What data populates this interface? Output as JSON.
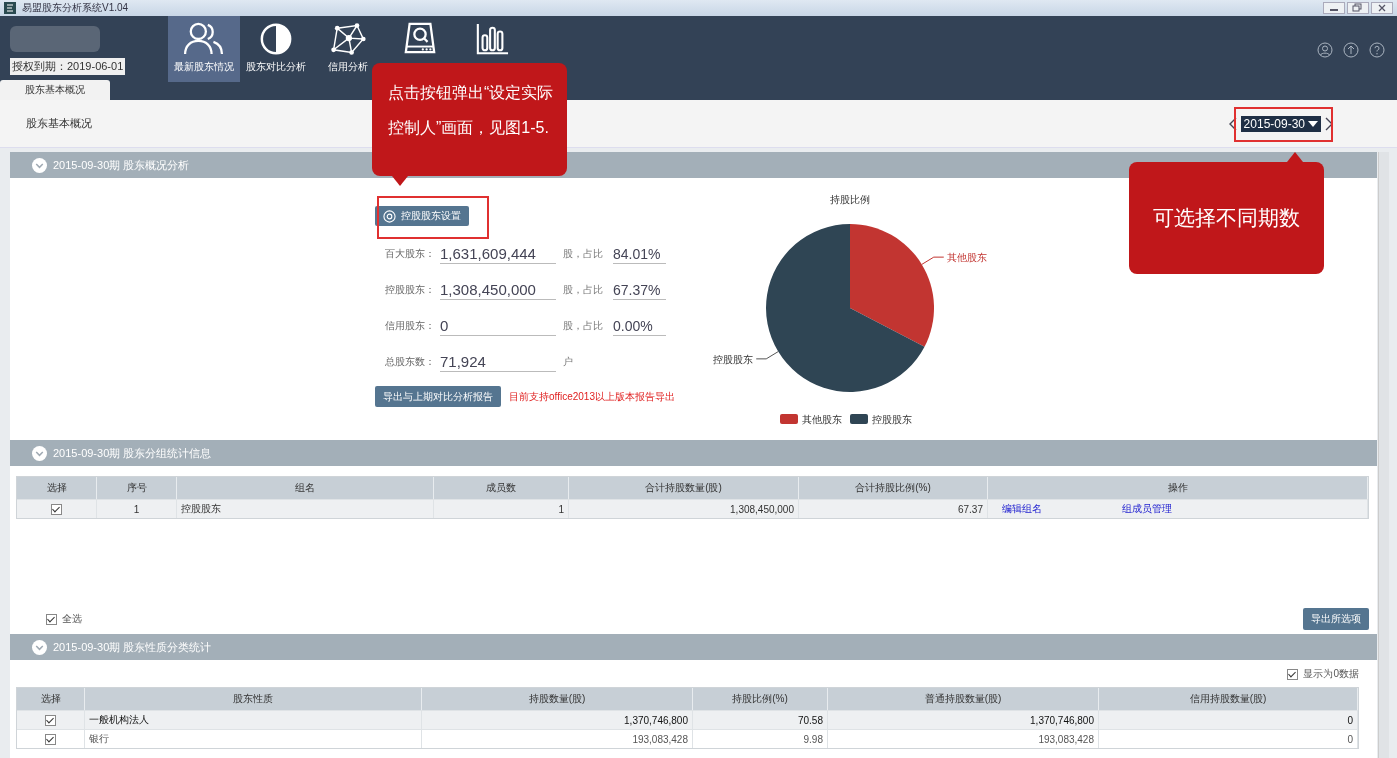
{
  "window": {
    "title": "易盟股东分析系统V1.04"
  },
  "license": "授权到期：2019-06-01",
  "nav": [
    {
      "kind": "people",
      "label": "最新股东情况",
      "selected": true
    },
    {
      "kind": "contrast",
      "label": "股东对比分析",
      "selected": false
    },
    {
      "kind": "network",
      "label": "信用分析",
      "selected": false
    },
    {
      "kind": "drive",
      "selected": false
    },
    {
      "kind": "bars",
      "selected": false
    }
  ],
  "tabs": [
    {
      "label": "股东基本概况",
      "selected": true
    }
  ],
  "page_title": "股东基本概况",
  "period": {
    "value": "2015-09-30"
  },
  "overview": {
    "header": "2015-09-30期 股东概况分析",
    "setting_button": "控股股东设置",
    "stats": [
      {
        "label": "百大股东：",
        "value": "1,631,609,444",
        "unit": "股，占比",
        "ratio": "84.01%"
      },
      {
        "label": "控股股东：",
        "value": "1,308,450,000",
        "unit": "股，占比",
        "ratio": "67.37%"
      },
      {
        "label": "信用股东：",
        "value": "0",
        "unit": "股，占比",
        "ratio": "0.00%"
      },
      {
        "label": "总股东数：",
        "value": "71,924",
        "unit": "户"
      }
    ],
    "export_button": "导出与上期对比分析报告",
    "note": "目前支持office2013以上版本报告导出",
    "chart_data": {
      "type": "pie",
      "title": "持股比例",
      "categories": [
        "其他股东",
        "控股股东"
      ],
      "series": [
        {
          "values": [
            32.63,
            67.37
          ]
        }
      ]
    },
    "legend": [
      {
        "label": "其他股东",
        "color": "#c23531"
      },
      {
        "label": "控股股东",
        "color": "#2f4554"
      }
    ]
  },
  "groups": {
    "header": "2015-09-30期 股东分组统计信息",
    "columns": [
      "选择",
      "序号",
      "组名",
      "成员数",
      "合计持股数量(股)",
      "合计持股比例(%)",
      "操作"
    ],
    "rows": [
      {
        "checked": true,
        "cells": [
          "",
          "1",
          "控股股东",
          "1",
          "1,308,450,000",
          "67.37"
        ],
        "actions": [
          "编辑组名",
          "组成员管理"
        ]
      }
    ],
    "select_all": {
      "label": "全选",
      "checked": true
    },
    "export_button": "导出所选项"
  },
  "nature": {
    "header": "2015-09-30期 股东性质分类统计",
    "show_zero": {
      "label": "显示为0数据",
      "checked": true
    },
    "columns": [
      "选择",
      "股东性质",
      "持股数量(股)",
      "持股比例(%)",
      "普通持股数量(股)",
      "信用持股数量(股)"
    ],
    "rows": [
      {
        "checked": true,
        "selected": true,
        "cells": [
          "",
          "一般机构法人",
          "1,370,746,800",
          "70.58",
          "1,370,746,800",
          "0"
        ]
      },
      {
        "checked": true,
        "selected": false,
        "cells": [
          "",
          "银行",
          "193,083,428",
          "9.98",
          "193,083,428",
          "0"
        ]
      }
    ]
  },
  "annotations": [
    {
      "text": "点击按钮弹出“设定实际控制人”画面，见图1-5."
    },
    {
      "text": "可选择不同期数"
    }
  ]
}
